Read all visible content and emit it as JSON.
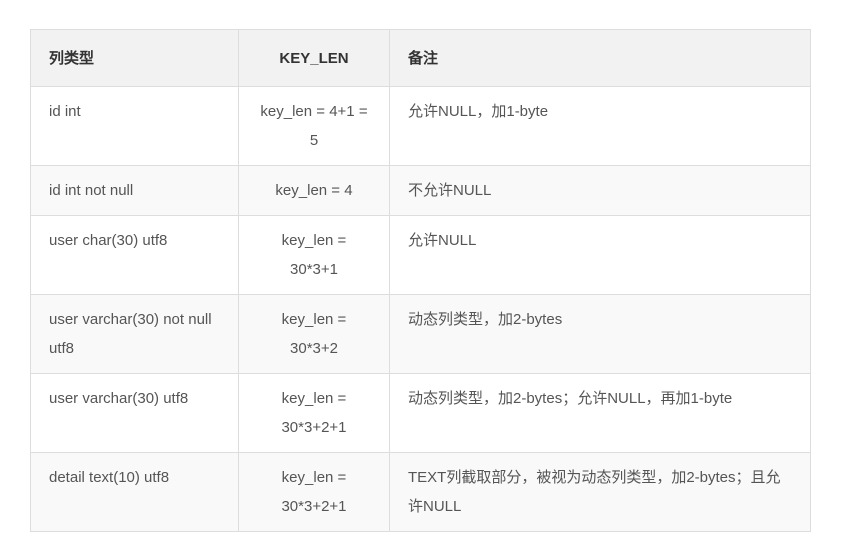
{
  "table": {
    "headers": [
      "列类型",
      "KEY_LEN",
      "备注"
    ],
    "rows": [
      [
        "id int",
        "key_len = 4+1 = 5",
        "允许NULL，加1-byte"
      ],
      [
        "id int not null",
        "key_len = 4",
        "不允许NULL"
      ],
      [
        "user char(30) utf8",
        "key_len = 30*3+1",
        "允许NULL"
      ],
      [
        "user varchar(30) not null utf8",
        "key_len = 30*3+2",
        "动态列类型，加2-bytes"
      ],
      [
        "user varchar(30) utf8",
        "key_len = 30*3+2+1",
        "动态列类型，加2-bytes；允许NULL，再加1-byte"
      ],
      [
        "detail text(10) utf8",
        "key_len = 30*3+2+1",
        "TEXT列截取部分，被视为动态列类型，加2-bytes；且允许NULL"
      ]
    ]
  }
}
